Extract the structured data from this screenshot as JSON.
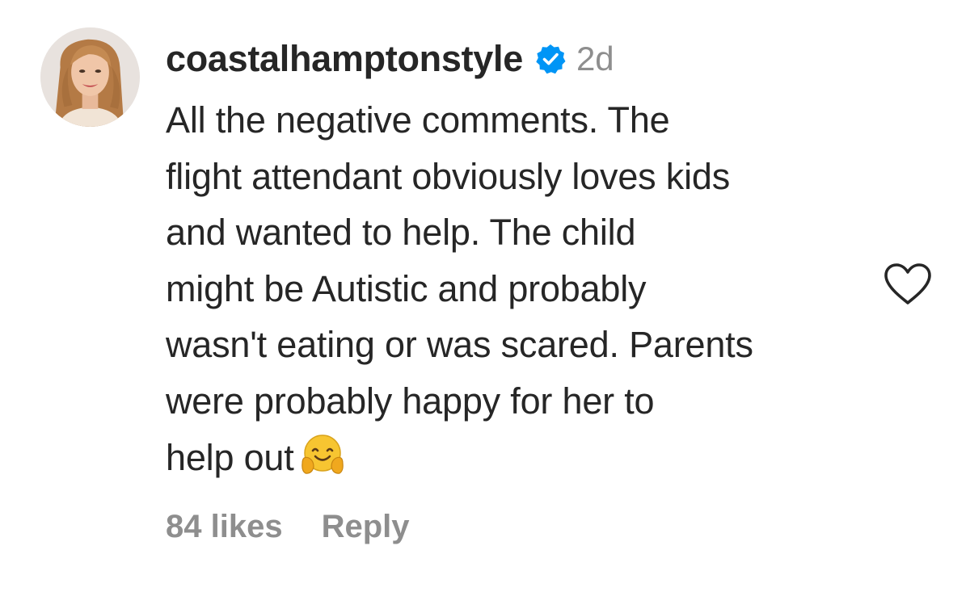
{
  "comment": {
    "username": "coastalhamptonstyle",
    "verified": true,
    "time": "2d",
    "text_lines": [
      "All the negative comments. The",
      "flight attendant obviously loves kids",
      "and wanted to help. The child",
      "might be Autistic and probably",
      "wasn't eating or was scared. Parents",
      "were probably happy for her to",
      "help out"
    ],
    "emoji": "🤗",
    "likes_label": "84 likes",
    "reply_label": "Reply"
  },
  "icons": {
    "avatar": "avatar-photo",
    "verified": "verified-badge-icon",
    "emoji": "hugging-face-emoji",
    "like": "heart-outline-icon"
  },
  "colors": {
    "text": "#262626",
    "secondary": "#8e8e8e",
    "verified": "#0095f6"
  }
}
